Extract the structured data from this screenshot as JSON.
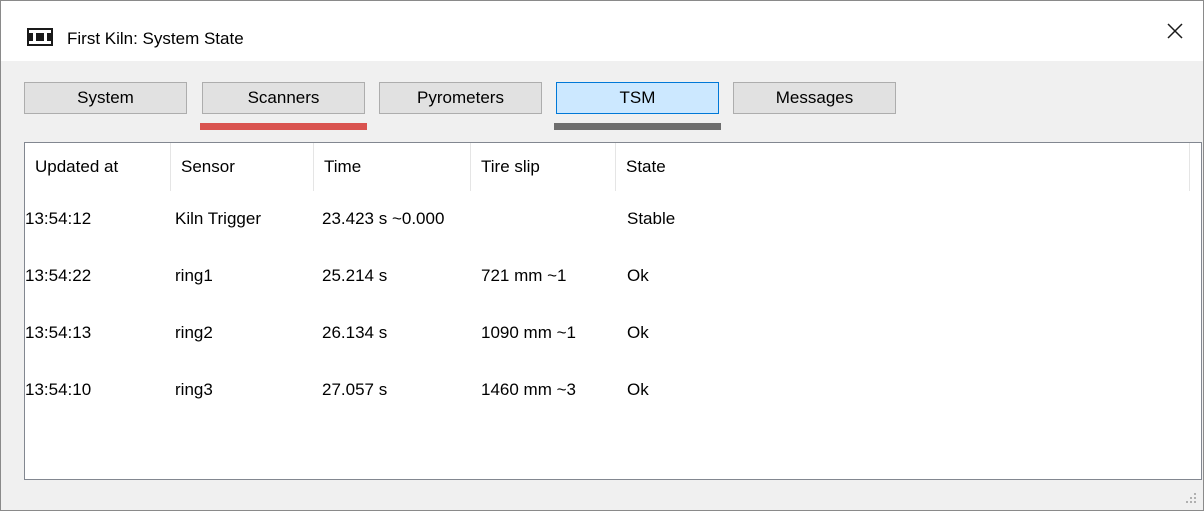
{
  "window": {
    "title": "First Kiln: System State"
  },
  "tabs": [
    {
      "label": "System",
      "active": false
    },
    {
      "label": "Scanners",
      "active": false,
      "indicator_color": "#d9534f"
    },
    {
      "label": "Pyrometers",
      "active": false
    },
    {
      "label": "TSM",
      "active": true,
      "indicator_color": "#6d6d6d"
    },
    {
      "label": "Messages",
      "active": false
    }
  ],
  "table": {
    "columns": [
      "Updated at",
      "Sensor",
      "Time",
      "Tire slip",
      "State"
    ],
    "rows": [
      {
        "updated_at": "13:54:12",
        "sensor": "Kiln Trigger",
        "time": "23.423 s ~0.000",
        "tire_slip": "",
        "state": "Stable"
      },
      {
        "updated_at": "13:54:22",
        "sensor": "ring1",
        "time": "25.214 s",
        "tire_slip": "721 mm ~1",
        "state": "Ok"
      },
      {
        "updated_at": "13:54:13",
        "sensor": "ring2",
        "time": "26.134 s",
        "tire_slip": "1090 mm ~1",
        "state": "Ok"
      },
      {
        "updated_at": "13:54:10",
        "sensor": "ring3",
        "time": "27.057 s",
        "tire_slip": "1460 mm ~3",
        "state": "Ok"
      }
    ]
  },
  "icons": {
    "app": "kiln-window-icon",
    "close": "close-icon",
    "resize": "resize-grip-icon"
  }
}
